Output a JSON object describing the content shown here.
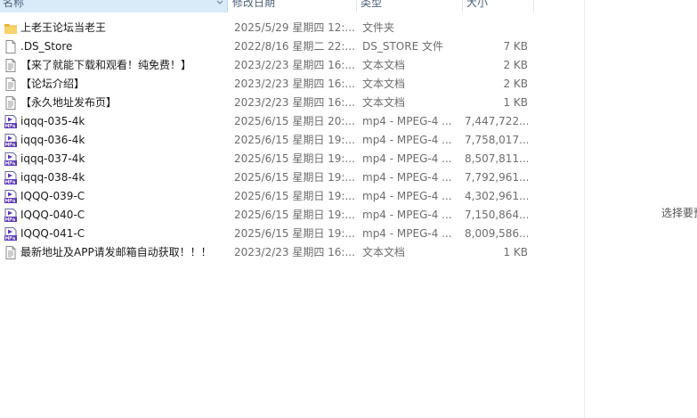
{
  "columns": {
    "name": "名称",
    "date": "修改日期",
    "type": "类型",
    "size": "大小"
  },
  "files": [
    {
      "name": "上老王论坛当老王",
      "date": "2025/5/29 星期四 12:...",
      "type": "文件夹",
      "size": "",
      "icon": "folder-icon"
    },
    {
      "name": ".DS_Store",
      "date": "2022/8/16 星期二 22:...",
      "type": "DS_STORE 文件",
      "size": "7 KB",
      "icon": "generic-file-icon"
    },
    {
      "name": "【来了就能下载和观看！纯免费！】",
      "date": "2023/2/23 星期四 16:...",
      "type": "文本文档",
      "size": "2 KB",
      "icon": "text-document-icon"
    },
    {
      "name": "【论坛介绍】",
      "date": "2023/2/23 星期四 16:...",
      "type": "文本文档",
      "size": "2 KB",
      "icon": "text-document-icon"
    },
    {
      "name": "【永久地址发布页】",
      "date": "2023/2/23 星期四 16:...",
      "type": "文本文档",
      "size": "1 KB",
      "icon": "text-document-icon"
    },
    {
      "name": "iqqq-035-4k",
      "date": "2025/6/15 星期日 20:...",
      "type": "mp4 - MPEG-4 ...",
      "size": "7,447,722...",
      "icon": "mp4-video-icon"
    },
    {
      "name": "iqqq-036-4k",
      "date": "2025/6/15 星期日 19:...",
      "type": "mp4 - MPEG-4 ...",
      "size": "7,758,017...",
      "icon": "mp4-video-icon"
    },
    {
      "name": "iqqq-037-4k",
      "date": "2025/6/15 星期日 19:...",
      "type": "mp4 - MPEG-4 ...",
      "size": "8,507,811...",
      "icon": "mp4-video-icon"
    },
    {
      "name": "iqqq-038-4k",
      "date": "2025/6/15 星期日 19:...",
      "type": "mp4 - MPEG-4 ...",
      "size": "7,792,961...",
      "icon": "mp4-video-icon"
    },
    {
      "name": "IQQQ-039-C",
      "date": "2025/6/15 星期日 19:...",
      "type": "mp4 - MPEG-4 ...",
      "size": "4,302,961...",
      "icon": "mp4-video-icon"
    },
    {
      "name": "IQQQ-040-C",
      "date": "2025/6/15 星期日 19:...",
      "type": "mp4 - MPEG-4 ...",
      "size": "7,150,864...",
      "icon": "mp4-video-icon"
    },
    {
      "name": "IQQQ-041-C",
      "date": "2025/6/15 星期日 19:...",
      "type": "mp4 - MPEG-4 ...",
      "size": "8,009,586...",
      "icon": "mp4-video-icon"
    },
    {
      "name": "最新地址及APP请发邮箱自动获取！！！",
      "date": "2023/2/23 星期四 16:...",
      "type": "文本文档",
      "size": "1 KB",
      "icon": "text-document-icon"
    }
  ],
  "preview": {
    "message": "选择要预览的文件。"
  },
  "colors": {
    "header_selected_bg": "#d9ebf9",
    "folder": "#f5c451",
    "mp4_badge": "#6a3fc1"
  }
}
